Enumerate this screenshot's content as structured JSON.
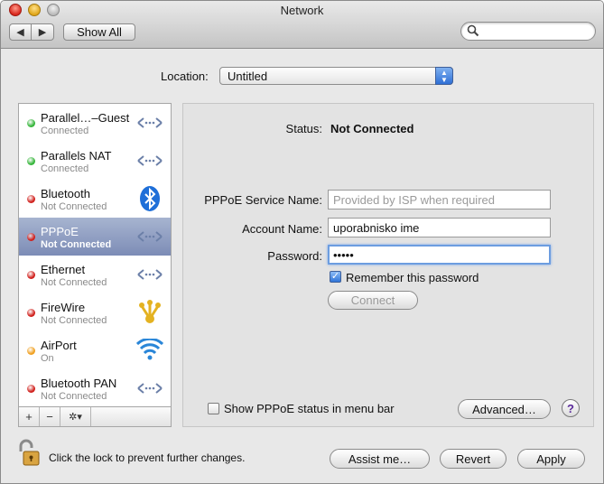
{
  "window": {
    "title": "Network"
  },
  "toolbar": {
    "show_all": "Show All",
    "back_icon": "◀",
    "forward_icon": "▶",
    "search_icon": "🔍"
  },
  "location": {
    "label": "Location:",
    "value": "Untitled"
  },
  "services": [
    {
      "name": "Parallel…–Guest",
      "status": "Connected",
      "color": "#35b53a",
      "icon": "ethernet-arrows-icon",
      "selected": false
    },
    {
      "name": "Parallels NAT",
      "status": "Connected",
      "color": "#35b53a",
      "icon": "ethernet-arrows-icon",
      "selected": false
    },
    {
      "name": "Bluetooth",
      "status": "Not Connected",
      "color": "#d0201c",
      "icon": "bluetooth-icon",
      "selected": false
    },
    {
      "name": "PPPoE",
      "status": "Not Connected",
      "color": "#d0201c",
      "icon": "ethernet-arrows-icon",
      "selected": true
    },
    {
      "name": "Ethernet",
      "status": "Not Connected",
      "color": "#d0201c",
      "icon": "ethernet-arrows-icon",
      "selected": false
    },
    {
      "name": "FireWire",
      "status": "Not Connected",
      "color": "#d0201c",
      "icon": "firewire-icon",
      "selected": false
    },
    {
      "name": "AirPort",
      "status": "On",
      "color": "#f0a020",
      "icon": "airport-wifi-icon",
      "selected": false
    },
    {
      "name": "Bluetooth PAN",
      "status": "Not Connected",
      "color": "#d0201c",
      "icon": "ethernet-arrows-icon",
      "selected": false
    }
  ],
  "list_toolbar": {
    "add": "+",
    "remove": "−",
    "action": "✲▾"
  },
  "detail": {
    "status_label": "Status:",
    "status_value": "Not Connected",
    "service_name_label": "PPPoE Service Name:",
    "service_name_placeholder": "Provided by ISP when required",
    "account_label": "Account Name:",
    "account_value": "uporabnisko ime",
    "password_label": "Password:",
    "password_value": "•••••",
    "remember_label": "Remember this password",
    "remember_checked": true,
    "connect": "Connect",
    "show_status_label": "Show PPPoE status in menu bar",
    "show_status_checked": false,
    "advanced": "Advanced…",
    "help": "?"
  },
  "footer": {
    "lock_text": "Click the lock to prevent further changes.",
    "assist": "Assist me…",
    "revert": "Revert",
    "apply": "Apply"
  }
}
